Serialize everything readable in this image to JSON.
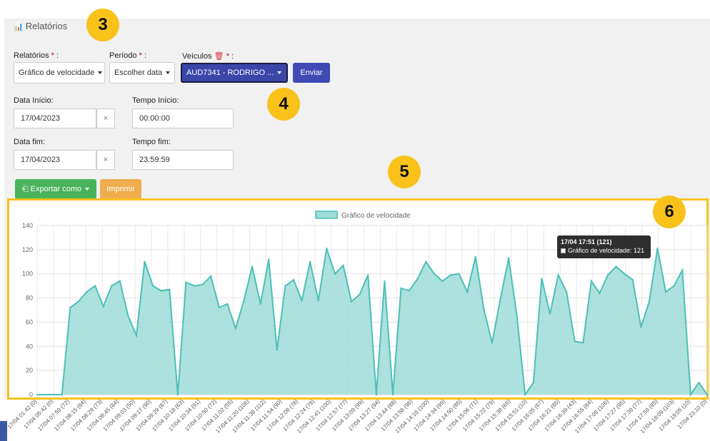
{
  "page": {
    "title_icon": "bar-chart-icon",
    "title": "Relatórios"
  },
  "form": {
    "relatorios_label": "Relatórios",
    "periodo_label": "Período",
    "veiculos_label": "Veículos",
    "required_mark": "*",
    "colon": ":",
    "relatorios_value": "Gráfico de velocidade",
    "periodo_value": "Escolher data",
    "veiculos_value": "AUD7341 - RODRIGO ...",
    "enviar": "Enviar",
    "data_inicio_label": "Data Início:",
    "tempo_inicio_label": "Tempo Início:",
    "data_inicio_value": "17/04/2023",
    "tempo_inicio_value": "00:00:00",
    "data_fim_label": "Data fim:",
    "tempo_fim_label": "Tempo fim:",
    "data_fim_value": "17/04/2023",
    "tempo_fim_value": "23:59:59",
    "clear_symbol": "×",
    "exportar": "Exportar como",
    "imprimir": "Imprimir"
  },
  "callouts": [
    "3",
    "4",
    "5",
    "6"
  ],
  "tooltip": {
    "title": "17/04 17:51 (121)",
    "body": "Gráfico de velocidade: 121"
  },
  "colors": {
    "accent_blue": "#3f4ab3",
    "export_green": "#49b35c",
    "print_orange": "#f0ad4e",
    "callout_yellow": "#f8c21b",
    "series_line": "#4bbfb8",
    "series_fill": "#9fdcd8"
  },
  "chart_data": {
    "type": "area",
    "legend": "Gráfico de velocidade",
    "legend_position": "top",
    "ylim": [
      0,
      140
    ],
    "yticks": [
      0,
      20,
      40,
      60,
      80,
      100,
      120,
      140
    ],
    "grid": true,
    "x_labels": [
      "17/04 01:42 (0)",
      "17/04 05:42 (0)",
      "17/04 07:59 (72)",
      "17/04 08:15 (84)",
      "17/04 08:29 (73)",
      "17/04 08:45 (84)",
      "17/04 09:03 (50)",
      "17/04 09:17 (90)",
      "17/04 09:29 (87)",
      "17/04 10:18 (63)",
      "17/04 10:34 (91)",
      "17/04 10:50 (72)",
      "17/04 11:02 (55)",
      "17/04 11:20 (106)",
      "17/04 11:38 (112)",
      "17/04 11:54 (90)",
      "17/04 12:08 (78)",
      "17/04 12:24 (78)",
      "17/04 12:41 (100)",
      "17/04 12:57 (77)",
      "17/04 13:09 (99)",
      "17/04 13:27 (94)",
      "17/04 13:44 (88)",
      "17/04 13:58 (96)",
      "17/04 14:16 (100)",
      "17/04 14:34 (99)",
      "17/04 14:50 (85)",
      "17/04 15:06 (71)",
      "17/04 15:22 (79)",
      "17/04 15:38 (65)",
      "17/04 15:51 (10)",
      "17/04 16:05 (67)",
      "17/04 16:21 (85)",
      "17/04 16:39 (43)",
      "17/04 16:55 (84)",
      "17/04 17:09 (106)",
      "17/04 17:27 (95)",
      "17/04 17:39 (77)",
      "17/04 17:59 (85)",
      "17/04 18:09 (103)",
      "17/04 19:05 (10)",
      "17/04 23:10 (0)"
    ],
    "values": [
      0,
      0,
      0,
      0,
      72,
      77,
      85,
      90,
      73,
      90,
      94,
      65,
      49,
      110,
      90,
      86,
      87,
      0,
      93,
      90,
      91,
      98,
      72,
      75,
      55,
      78,
      106,
      75,
      112,
      37,
      90,
      95,
      78,
      110,
      78,
      121,
      100,
      107,
      77,
      83,
      99,
      0,
      94,
      0,
      88,
      86,
      96,
      110,
      100,
      94,
      99,
      100,
      85,
      114,
      71,
      43,
      79,
      113,
      65,
      0,
      10,
      96,
      67,
      99,
      85,
      44,
      43,
      94,
      84,
      99,
      106,
      100,
      95,
      56,
      77,
      121,
      85,
      90,
      103,
      0,
      10,
      0
    ]
  }
}
